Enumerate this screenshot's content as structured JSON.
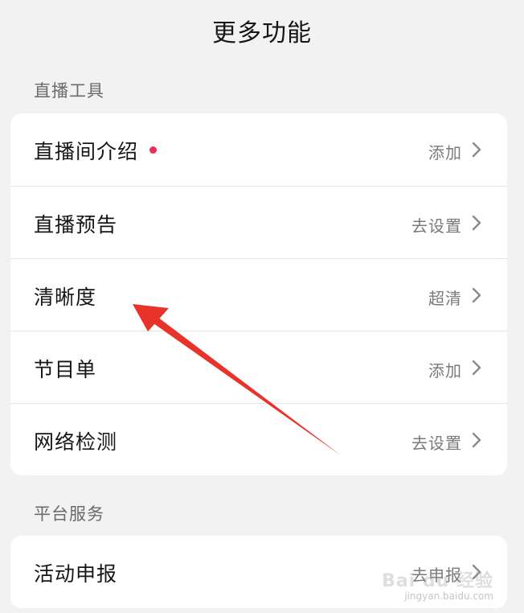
{
  "header": {
    "title": "更多功能"
  },
  "sections": [
    {
      "title": "直播工具",
      "rows": [
        {
          "label": "直播间介绍",
          "value": "添加",
          "dot": true
        },
        {
          "label": "直播预告",
          "value": "去设置"
        },
        {
          "label": "清晰度",
          "value": "超清"
        },
        {
          "label": "节目单",
          "value": "添加"
        },
        {
          "label": "网络检测",
          "value": "去设置"
        }
      ]
    },
    {
      "title": "平台服务",
      "rows": [
        {
          "label": "活动申报",
          "value": "去申报"
        }
      ]
    }
  ],
  "annotation": {
    "arrow_color": "#e8332a"
  },
  "watermark": {
    "brand": "Bai du 经验",
    "url": "jingyan.baidu.com"
  },
  "colors": {
    "background": "#f2f2f2",
    "card": "#ffffff",
    "accent_dot": "#f02c55",
    "value_text": "#7a7a7a"
  }
}
